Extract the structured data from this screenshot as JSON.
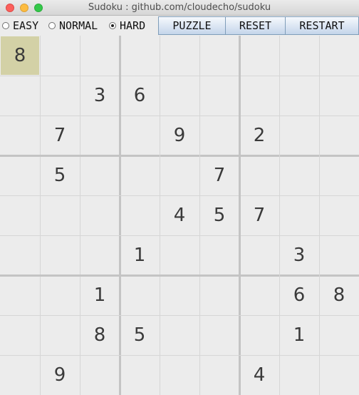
{
  "window": {
    "title": "Sudoku : github.com/cloudecho/sudoku"
  },
  "toolbar": {
    "difficulties": [
      {
        "label": "EASY",
        "checked": false
      },
      {
        "label": "NORMAL",
        "checked": false
      },
      {
        "label": "HARD",
        "checked": true
      }
    ],
    "puzzle_label": "PUZZLE",
    "reset_label": "RESET",
    "restart_label": "RESTART"
  },
  "board": {
    "selected_cell": [
      0,
      0
    ],
    "selected_color": "#d3d1a6",
    "grid": [
      [
        "8",
        "",
        "",
        "",
        "",
        "",
        "",
        "",
        ""
      ],
      [
        "",
        "",
        "3",
        "6",
        "",
        "",
        "",
        "",
        ""
      ],
      [
        "",
        "7",
        "",
        "",
        "9",
        "",
        "2",
        "",
        ""
      ],
      [
        "",
        "5",
        "",
        "",
        "",
        "7",
        "",
        "",
        ""
      ],
      [
        "",
        "",
        "",
        "",
        "4",
        "5",
        "7",
        "",
        ""
      ],
      [
        "",
        "",
        "",
        "1",
        "",
        "",
        "",
        "3",
        ""
      ],
      [
        "",
        "",
        "1",
        "",
        "",
        "",
        "",
        "6",
        "8"
      ],
      [
        "",
        "",
        "8",
        "5",
        "",
        "",
        "",
        "1",
        ""
      ],
      [
        "",
        "9",
        "",
        "",
        "",
        "",
        "4",
        "",
        ""
      ]
    ]
  }
}
